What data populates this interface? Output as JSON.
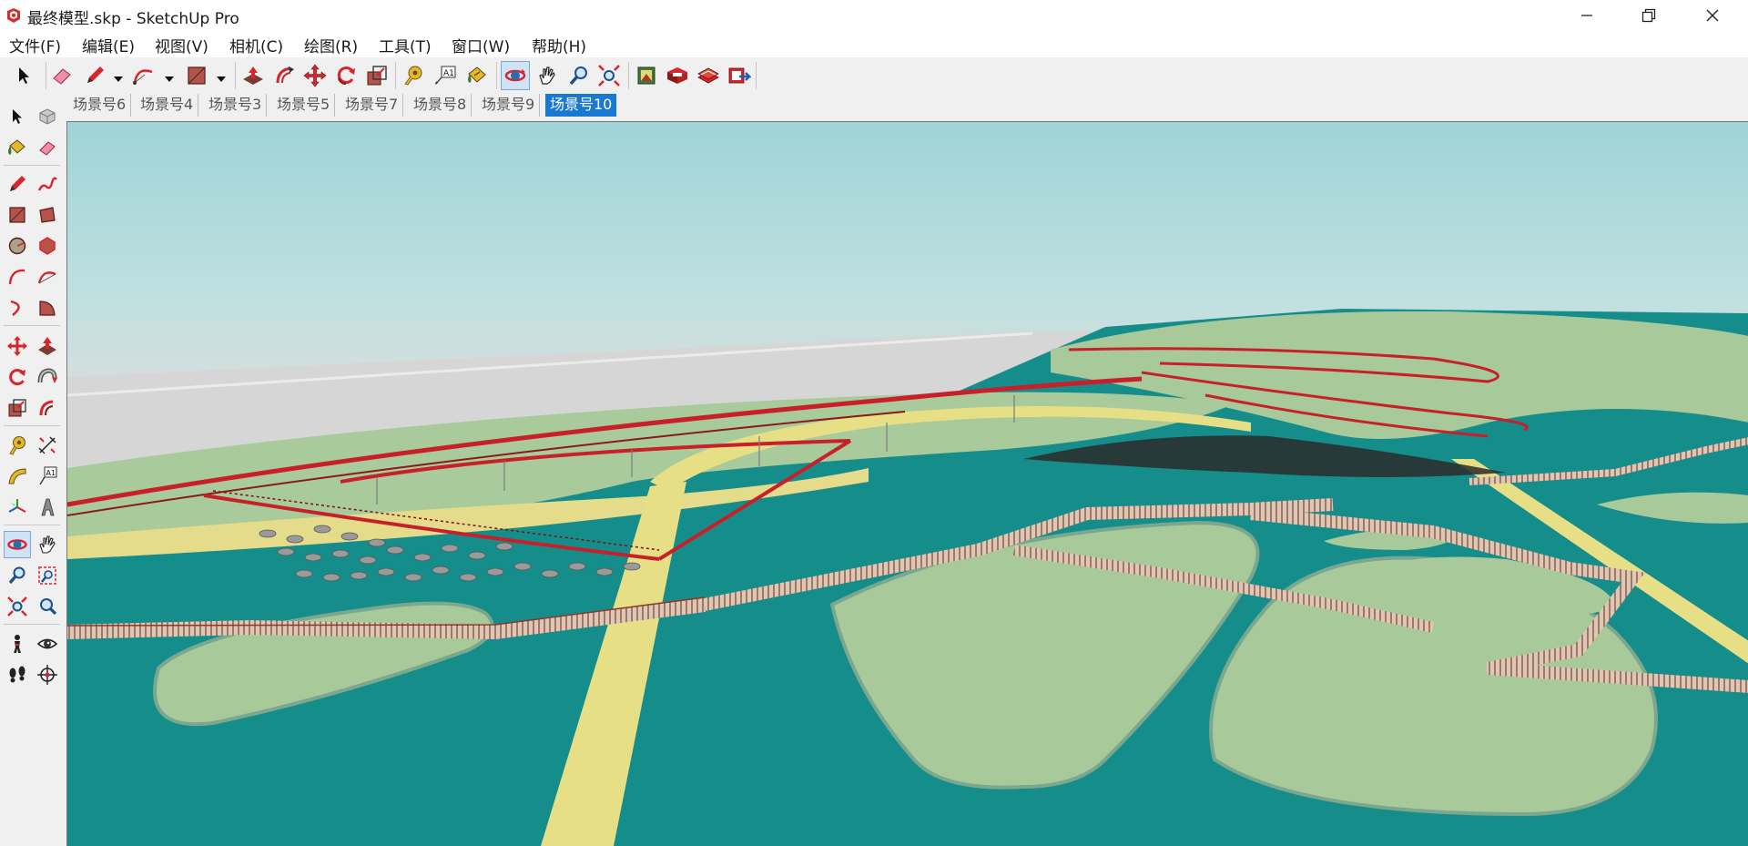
{
  "window": {
    "title": "最终模型.skp - SketchUp Pro",
    "app_icon": "sketchup-logo-icon",
    "controls": [
      "minimize-icon",
      "maximize-icon",
      "close-icon"
    ]
  },
  "menu": {
    "items": [
      "文件(F)",
      "编辑(E)",
      "视图(V)",
      "相机(C)",
      "绘图(R)",
      "工具(T)",
      "窗口(W)",
      "帮助(H)"
    ]
  },
  "toolbar": {
    "tools": [
      "select",
      "eraser",
      "line",
      "line-dropdown",
      "arc",
      "arc-dropdown",
      "rectangle",
      "rectangle-dropdown",
      "push-pull",
      "offset",
      "move",
      "rotate",
      "scale",
      "tape-measure",
      "text",
      "paint-bucket",
      "orbit",
      "pan",
      "zoom",
      "zoom-extents",
      "warehouse",
      "extension-warehouse",
      "layout",
      "send-to-layout"
    ]
  },
  "scenes": {
    "tabs": [
      "场景号6",
      "场景号4",
      "场景号3",
      "场景号5",
      "场景号7",
      "场景号8",
      "场景号9",
      "场景号10"
    ],
    "active_index": 7
  },
  "left_toolbar": {
    "tools": [
      "select",
      "component",
      "paint",
      "eraser",
      "line",
      "freehand",
      "rectangle",
      "rotated-rectangle",
      "circle",
      "polygon",
      "arc",
      "2-point-arc",
      "3-point-arc",
      "pie",
      "move",
      "push-pull",
      "rotate",
      "follow-me",
      "scale",
      "offset",
      "tape-measure",
      "dimension",
      "protractor",
      "text",
      "axes",
      "3d-text",
      "orbit",
      "pan",
      "zoom",
      "zoom-window",
      "zoom-extents",
      "previous-view",
      "position-camera",
      "look-around",
      "walk",
      "section-plane"
    ]
  },
  "viewport": {
    "content": "3d-model-landscape",
    "colors": {
      "sky": "#a9d8dc",
      "water": "#138e8c",
      "land": "#a8c99a",
      "path": "#e6e08a",
      "railing": "#c8202a"
    }
  }
}
